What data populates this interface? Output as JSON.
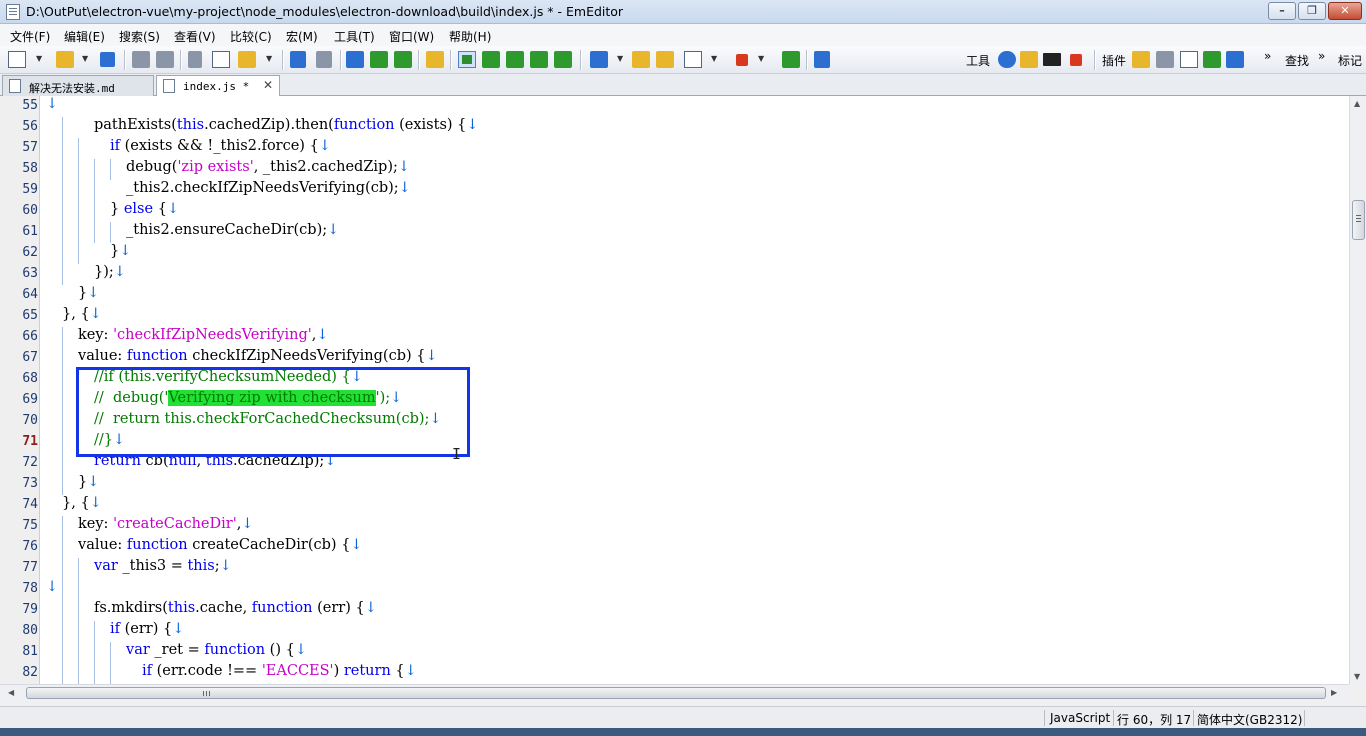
{
  "window": {
    "title": "D:\\OutPut\\electron-vue\\my-project\\node_modules\\electron-download\\build\\index.js * - EmEditor"
  },
  "menu": [
    "文件(F)",
    "编辑(E)",
    "搜索(S)",
    "查看(V)",
    "比较(C)",
    "宏(M)",
    "工具(T)",
    "窗口(W)",
    "帮助(H)"
  ],
  "toolbar": {
    "tools_label": "工具",
    "plugins_label": "插件",
    "find_label": "查找",
    "more": "»",
    "bookmark_label": "标记"
  },
  "tabs": [
    {
      "label": "解决无法安装.md",
      "active": false
    },
    {
      "label": "index.js *",
      "active": true,
      "close": "✕"
    }
  ],
  "editor": {
    "newline_mark": "↓",
    "current_line": 71,
    "lines": [
      {
        "n": 55
      },
      {
        "n": 56
      },
      {
        "n": 57
      },
      {
        "n": 58
      },
      {
        "n": 59
      },
      {
        "n": 60
      },
      {
        "n": 61
      },
      {
        "n": 62
      },
      {
        "n": 63
      },
      {
        "n": 64
      },
      {
        "n": 65
      },
      {
        "n": 66
      },
      {
        "n": 67
      },
      {
        "n": 68
      },
      {
        "n": 69
      },
      {
        "n": 70
      },
      {
        "n": 71
      },
      {
        "n": 72
      },
      {
        "n": 73
      },
      {
        "n": 74
      },
      {
        "n": 75
      },
      {
        "n": 76
      },
      {
        "n": 77
      },
      {
        "n": 78
      },
      {
        "n": 79
      },
      {
        "n": 80
      },
      {
        "n": 81
      },
      {
        "n": 82
      }
    ],
    "code": {
      "l56": {
        "a": "pathExists(",
        "b": "this",
        "c": ".cachedZip).then(",
        "d": "function",
        "e": " (exists) {"
      },
      "l57": {
        "a": "if",
        "b": " (exists && !_this2.force) {"
      },
      "l58": {
        "a": "debug(",
        "b": "'zip exists'",
        "c": ", _this2.cachedZip);"
      },
      "l59": {
        "a": "_this2.checkIfZipNeedsVerifying(cb);"
      },
      "l60": {
        "a": "} ",
        "b": "else",
        "c": " {"
      },
      "l61": {
        "a": "_this2.ensureCacheDir(cb);"
      },
      "l62": {
        "a": "}"
      },
      "l63": {
        "a": "});"
      },
      "l64": {
        "a": "}"
      },
      "l65": {
        "a": "}, {"
      },
      "l66": {
        "a": "key: ",
        "b": "'checkIfZipNeedsVerifying'",
        "c": ","
      },
      "l67": {
        "a": "value: ",
        "b": "function",
        "c": " checkIfZipNeedsVerifying(cb) {"
      },
      "l68": {
        "a": "//if (this.verifyChecksumNeeded) {"
      },
      "l69": {
        "a": "//  debug('",
        "b": "Verifying zip with checksum",
        "c": "');"
      },
      "l70": {
        "a": "//  return this.checkForCachedChecksum(cb);"
      },
      "l71": {
        "a": "//}"
      },
      "l72": {
        "a": "return",
        "b": " cb(",
        "c": "null",
        "d": ", ",
        "e": "this",
        "f": ".cachedZip);"
      },
      "l73": {
        "a": "}"
      },
      "l74": {
        "a": "}, {"
      },
      "l75": {
        "a": "key: ",
        "b": "'createCacheDir'",
        "c": ","
      },
      "l76": {
        "a": "value: ",
        "b": "function",
        "c": " createCacheDir(cb) {"
      },
      "l77": {
        "a": "var",
        "b": " _this3 = ",
        "c": "this",
        "d": ";"
      },
      "l79": {
        "a": "fs.mkdirs(",
        "b": "this",
        "c": ".cache, ",
        "d": "function",
        "e": " (err) {"
      },
      "l80": {
        "a": "if",
        "b": " (err) {"
      },
      "l81": {
        "a": "var",
        "b": " _ret = ",
        "c": "function",
        "d": " () {"
      },
      "l82": {
        "a": "if",
        "b": " (err.code !== ",
        "c": "'EACCES'",
        "d": ") ",
        "e": "return",
        "f": " {"
      }
    }
  },
  "status": {
    "language": "JavaScript",
    "position": "行 60，列 17",
    "encoding": "简体中文(GB2312)"
  },
  "colors": {
    "keyword": "#0000ee",
    "string": "#c800c8",
    "comment": "#007a00",
    "highlight": "#21e234",
    "annotation_box": "#1434e8"
  }
}
